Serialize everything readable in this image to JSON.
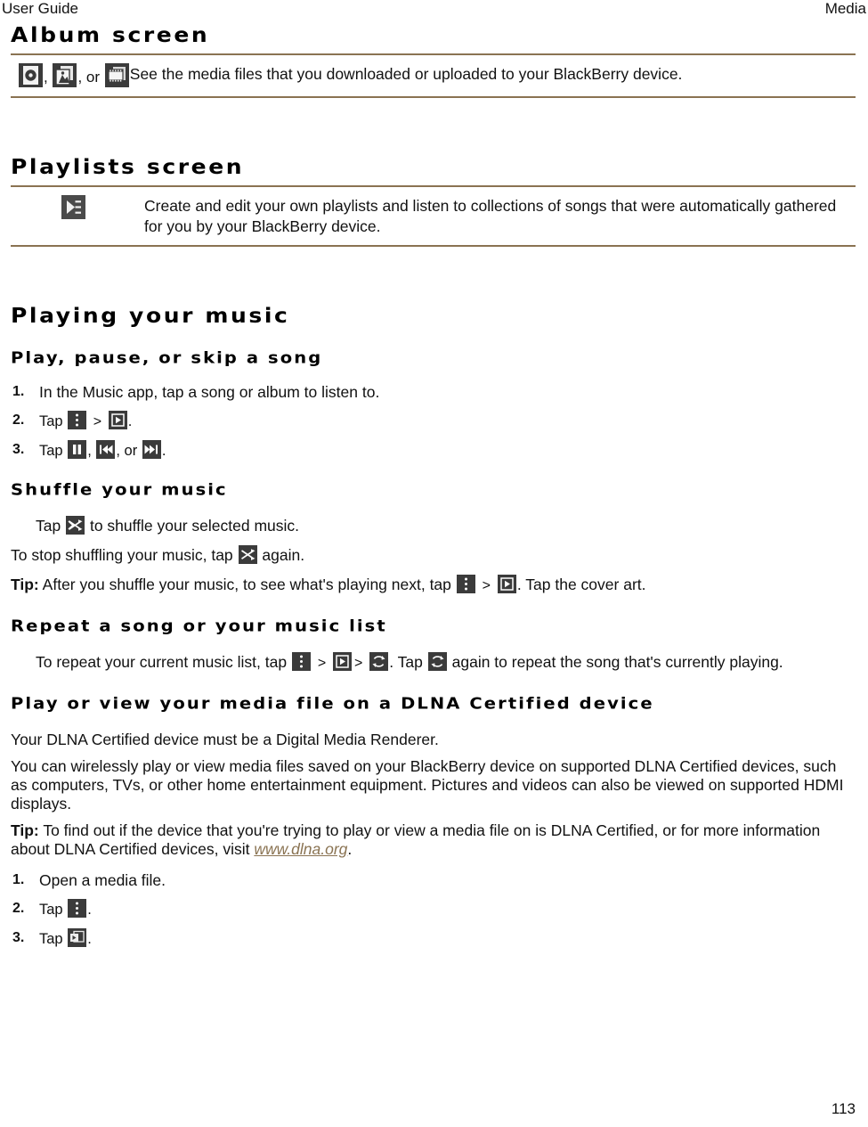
{
  "header": {
    "left": "User Guide",
    "right": "Media"
  },
  "sections": {
    "album": {
      "heading": "Album screen",
      "icons": [
        {
          "name": "music-album-icon",
          "sep": ","
        },
        {
          "name": "pictures-icon",
          "sep": ", or"
        },
        {
          "name": "videos-icon",
          "sep": ""
        }
      ],
      "description": "See the media files that you downloaded or uploaded to your BlackBerry device."
    },
    "playlists": {
      "heading": "Playlists screen",
      "icon": "playlist-icon",
      "description": "Create and edit your own playlists and listen to collections of songs that were automatically gathered for you by your BlackBerry device."
    },
    "playing_your_music": {
      "heading": "Playing your music"
    },
    "play_pause_skip": {
      "heading": "Play, pause, or skip a song",
      "steps": [
        {
          "num": "1.",
          "text": "In the Music app, tap a song or album to listen to."
        },
        {
          "num": "2.",
          "prefix": "Tap",
          "mid": ">",
          "suffix": "."
        },
        {
          "num": "3.",
          "prefix": "Tap",
          "sep1": ",",
          "sep2": ", or",
          "suffix": "."
        }
      ]
    },
    "shuffle": {
      "heading": "Shuffle your music",
      "line1_prefix": "Tap",
      "line1_suffix": "to shuffle your selected music.",
      "line2_prefix": "To stop shuffling your music, tap",
      "line2_suffix": "again.",
      "tip_label": "Tip:",
      "tip_prefix": "After you shuffle your music, to see what's playing next, tap",
      "tip_mid": ">",
      "tip_suffix": ". Tap the cover art."
    },
    "repeat": {
      "heading": "Repeat a song or your music list",
      "prefix": "To repeat your current music list, tap",
      "mid1": ">",
      "mid2": ">",
      "mid3": ". Tap",
      "suffix": "again to repeat the song that's currently playing."
    },
    "dlna": {
      "heading": "Play or view your media file on a DLNA Certified device",
      "para1": "Your DLNA Certified device must be a Digital Media Renderer.",
      "para2": "You can wirelessly play or view media files saved on your BlackBerry device on supported DLNA Certified devices, such as computers, TVs, or other home entertainment equipment. Pictures and videos can also be viewed on supported HDMI displays.",
      "tip_label": "Tip:",
      "tip_text_before": "To find out if the device that you're trying to play or view a media file on is DLNA Certified, or for more information about DLNA Certified devices, visit",
      "tip_link": "www.dlna.org",
      "tip_text_after": ".",
      "steps": [
        {
          "num": "1.",
          "text": "Open a media file."
        },
        {
          "num": "2.",
          "prefix": "Tap",
          "suffix": "."
        },
        {
          "num": "3.",
          "prefix": "Tap",
          "suffix": "."
        }
      ]
    }
  },
  "footer": {
    "page_number": "113"
  },
  "colors": {
    "rule": "#8a7352",
    "link": "#8a7352",
    "icon_background": "#3b3b3b",
    "text": "#111111"
  }
}
